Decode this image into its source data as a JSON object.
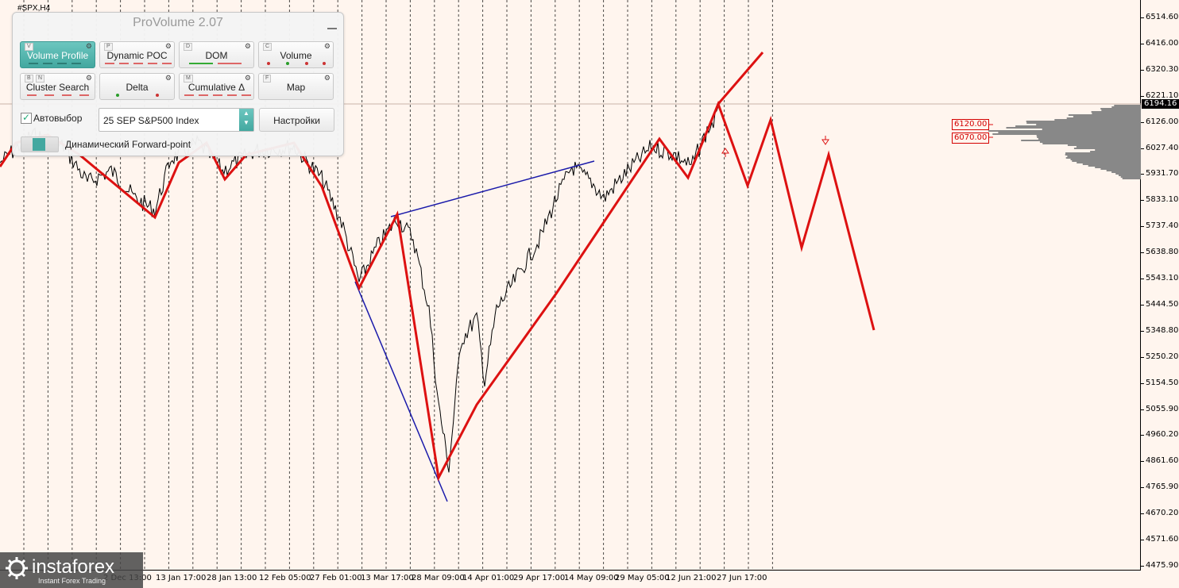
{
  "chart": {
    "symbol": "#SPX,H4",
    "current_price": "6194.16",
    "price_levels": [
      "6514.60",
      "6416.00",
      "6320.30",
      "6221.10",
      "6126.00",
      "6027.40",
      "5931.70",
      "5833.10",
      "5737.40",
      "5638.80",
      "5543.10",
      "5444.50",
      "5348.80",
      "5250.20",
      "5154.50",
      "5055.90",
      "4960.20",
      "4861.60",
      "4765.90",
      "4670.20",
      "4571.60",
      "4475.90"
    ],
    "time_labels": [
      "2 Dec 13:00",
      "13 Jan 17:00",
      "28 Jan 13:00",
      "12 Feb 05:00",
      "27 Feb 01:00",
      "13 Mar 17:00",
      "28 Mar 09:00",
      "14 Apr 01:00",
      "29 Apr 17:00",
      "14 May 09:00",
      "29 May 05:00",
      "12 Jun 21:00",
      "27 Jun 17:00"
    ],
    "levels": [
      "6120.00",
      "6070.00"
    ],
    "colors": {
      "wave": "#dd1111",
      "trend": "#1a1aaa",
      "profile": "#888888",
      "background": "#fff5ee"
    }
  },
  "provolume": {
    "title": "ProVolume 2.07",
    "buttons": [
      {
        "hotkey": "V",
        "label": "Volume Profile"
      },
      {
        "hotkey": "P",
        "label": "Dynamic POC"
      },
      {
        "hotkey": "D",
        "label": "DOM"
      },
      {
        "hotkey": "C",
        "label": "Volume"
      },
      {
        "hotkey": "B",
        "hotkey2": "N",
        "label": "Cluster Search"
      },
      {
        "hotkey": "",
        "label": "Delta"
      },
      {
        "hotkey": "M",
        "label": "Cumulative Δ"
      },
      {
        "hotkey": "F",
        "label": "Map"
      }
    ],
    "autoselect_label": "Автовыбор",
    "autoselect_checked": true,
    "instrument": "25 SEP S&P500 Index",
    "settings_label": "Настройки",
    "forward_point_label": "Динамический Forward-point"
  },
  "watermark": {
    "brand": "instaforex",
    "tagline": "Instant Forex Trading"
  }
}
